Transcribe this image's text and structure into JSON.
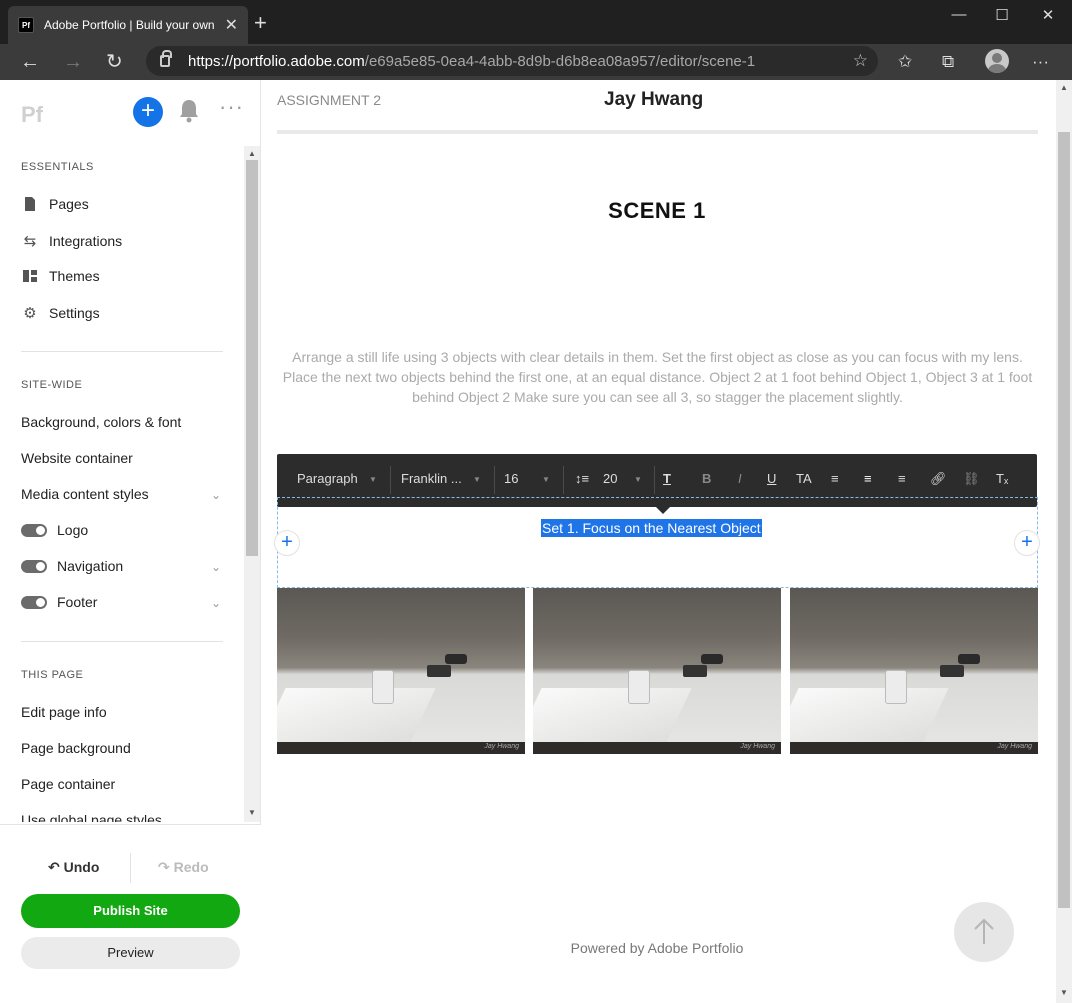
{
  "browser": {
    "tab_title": "Adobe Portfolio | Build your own personal website",
    "tab_favicon": "Pf",
    "url_host": "https://portfolio.adobe.com",
    "url_path": "/e69a5e85-0ea4-4abb-8d9b-d6b8ea08a957/editor/scene-1"
  },
  "sidebar": {
    "logo": "Pf",
    "sections": {
      "essentials": "ESSENTIALS",
      "site_wide": "SITE-WIDE",
      "this_page": "THIS PAGE"
    },
    "essentials_items": [
      {
        "label": "Pages",
        "icon": "page-icon"
      },
      {
        "label": "Integrations",
        "icon": "integrations-icon"
      },
      {
        "label": "Themes",
        "icon": "themes-icon"
      },
      {
        "label": "Settings",
        "icon": "gear-icon"
      }
    ],
    "site_wide_items": [
      {
        "label": "Background, colors & font"
      },
      {
        "label": "Website container"
      },
      {
        "label": "Media content styles"
      },
      {
        "label": "Logo",
        "toggle": true
      },
      {
        "label": "Navigation",
        "toggle": true
      },
      {
        "label": "Footer",
        "toggle": true
      }
    ],
    "this_page_items": [
      {
        "label": "Edit page info"
      },
      {
        "label": "Page background"
      },
      {
        "label": "Page container"
      },
      {
        "label": "Use global page styles"
      }
    ],
    "undo": "Undo",
    "redo": "Redo",
    "publish": "Publish Site",
    "preview": "Preview"
  },
  "page": {
    "assignment": "ASSIGNMENT 2",
    "site_name": "Jay Hwang",
    "scene_title": "SCENE 1",
    "description": "Arrange a still life using 3 objects with clear details in them. Set the first object as close as you can focus with my lens. Place the next two objects behind the first one, at an equal distance. Object 2 at 1 foot behind Object 1, Object 3 at 1 foot behind Object 2 Make sure you can see all 3, so stagger the placement slightly.",
    "selected_text": "Set 1. Focus on the Nearest Object",
    "photo_signature": "Jay Hwang",
    "powered_by": "Powered by Adobe Portfolio"
  },
  "text_toolbar": {
    "paragraph": "Paragraph",
    "font": "Franklin ...",
    "size": "16",
    "line_height": "20",
    "text_transform": "TA"
  },
  "colors": {
    "accent": "#1473e6",
    "publish": "#12a812",
    "selection": "#1f74e8"
  }
}
